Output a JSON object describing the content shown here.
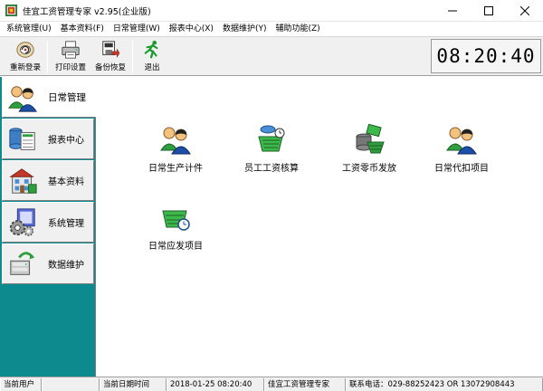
{
  "window": {
    "title": "佳宜工资管理专家  v2.95(企业版)",
    "controls": [
      "minimize",
      "maximize",
      "close"
    ]
  },
  "menu": {
    "items": [
      {
        "label": "系统管理(U)"
      },
      {
        "label": "基本资料(F)"
      },
      {
        "label": "日常管理(W)"
      },
      {
        "label": "报表中心(X)"
      },
      {
        "label": "数据维护(Y)"
      },
      {
        "label": "辅助功能(Z)"
      }
    ]
  },
  "toolbar": {
    "buttons": [
      {
        "label": "重新登录",
        "icon": "relogin-icon"
      },
      {
        "label": "打印设置",
        "icon": "printer-icon"
      },
      {
        "label": "备份恢复",
        "icon": "backup-icon"
      },
      {
        "label": "退出",
        "icon": "exit-runner-icon"
      }
    ],
    "clock": "08:20:40"
  },
  "sidebar": {
    "items": [
      {
        "label": "日常管理",
        "icon": "people-icon",
        "active": true
      },
      {
        "label": "报表中心",
        "icon": "report-icon",
        "active": false
      },
      {
        "label": "基本资料",
        "icon": "building-icon",
        "active": false
      },
      {
        "label": "系统管理",
        "icon": "gears-icon",
        "active": false
      },
      {
        "label": "数据维护",
        "icon": "database-icon",
        "active": false
      }
    ]
  },
  "main": {
    "tiles": [
      {
        "label": "日常生产计件",
        "icon": "people-icon"
      },
      {
        "label": "员工工资核算",
        "icon": "calculate-basket-icon"
      },
      {
        "label": "工资零币发放",
        "icon": "coins-money-icon"
      },
      {
        "label": "日常代扣项目",
        "icon": "people-icon"
      },
      {
        "label": "日常应发项目",
        "icon": "basket-clock-icon"
      }
    ]
  },
  "status": {
    "cells": [
      {
        "label": "当前用户"
      },
      {
        "label": ""
      },
      {
        "label": "当前日期时间"
      },
      {
        "label": "2018-01-25 08:20:40"
      },
      {
        "label": "佳宜工资管理专家"
      },
      {
        "label": "联系电话：029-88252423  OR  13072908443"
      }
    ]
  }
}
